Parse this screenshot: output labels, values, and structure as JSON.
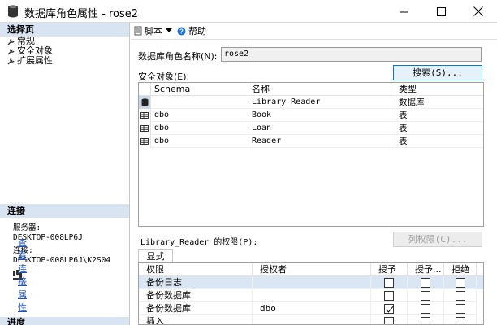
{
  "window": {
    "title": "数据库角色属性 - rose2",
    "minimize_label": "─",
    "maximize_label": "☐",
    "close_label": "✕"
  },
  "left_pane": {
    "select_page_header": "选择页",
    "pages": [
      {
        "label": "常规",
        "icon": "wrench-icon"
      },
      {
        "label": "安全对象",
        "icon": "wrench-icon"
      },
      {
        "label": "扩展属性",
        "icon": "wrench-icon"
      }
    ],
    "connection_header": "连接",
    "server_label": "服务器:",
    "server_value": "DESKTOP-008LP6J",
    "connection_label": "连接:",
    "connection_value": "DESKTOP-008LP6J\\K2S04",
    "view_connection_link": "查看连接属性",
    "progress_header": "进度"
  },
  "toolbar": {
    "script_label": "脚本",
    "help_label": "帮助"
  },
  "form": {
    "role_name_label": "数据库角色名称(N):",
    "role_name_value": "rose2",
    "securables_label": "安全对象(E):",
    "search_button": "搜索(S)...",
    "permissions_label": "Library_Reader 的权限(P):",
    "column_permissions_button": "列权限(C)...",
    "explicit_tab": "显式"
  },
  "securables_table": {
    "columns": [
      "Schema",
      "名称",
      "类型"
    ],
    "rows": [
      {
        "schema": "",
        "name": "Library_Reader",
        "type": "数据库",
        "icon": "database-icon"
      },
      {
        "schema": "dbo",
        "name": "Book",
        "type": "表",
        "icon": "table-icon"
      },
      {
        "schema": "dbo",
        "name": "Loan",
        "type": "表",
        "icon": "table-icon"
      },
      {
        "schema": "dbo",
        "name": "Reader",
        "type": "表",
        "icon": "table-icon"
      }
    ]
  },
  "permissions_table": {
    "columns": [
      "权限",
      "授权者",
      "授予",
      "授予...",
      "拒绝"
    ],
    "rows": [
      {
        "permission": "备份日志",
        "grantor": "",
        "grant": false,
        "with_grant": false,
        "deny": false
      },
      {
        "permission": "备份数据库",
        "grantor": "",
        "grant": false,
        "with_grant": false,
        "deny": false
      },
      {
        "permission": "备份数据库",
        "grantor": "dbo",
        "grant": true,
        "with_grant": false,
        "deny": false
      },
      {
        "permission": "插入",
        "grantor": "",
        "grant": false,
        "with_grant": false,
        "deny": false
      }
    ]
  }
}
